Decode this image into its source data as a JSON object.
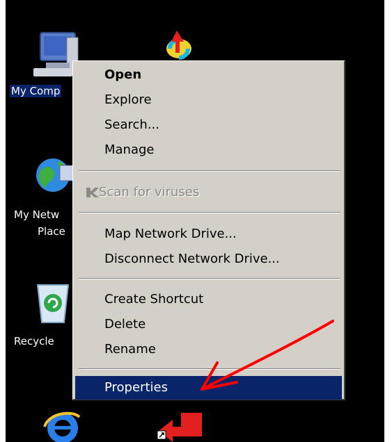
{
  "desktop": {
    "icons": [
      {
        "name": "my-computer",
        "label": "My Comp"
      },
      {
        "name": "my-network-places",
        "label_line1": "My Netw",
        "label_line2": "Place"
      },
      {
        "name": "recycle-bin",
        "label": "Recycle"
      },
      {
        "name": "internet-explorer",
        "label": ""
      }
    ]
  },
  "context_menu": {
    "items": [
      {
        "label": "Open",
        "bold": true
      },
      {
        "label": "Explore"
      },
      {
        "label": "Search..."
      },
      {
        "label": "Manage"
      },
      {
        "label": "Scan for viruses",
        "disabled": true,
        "icon": "kaspersky-icon"
      },
      {
        "label": "Map Network Drive..."
      },
      {
        "label": "Disconnect Network Drive..."
      },
      {
        "label": "Create Shortcut"
      },
      {
        "label": "Delete"
      },
      {
        "label": "Rename"
      },
      {
        "label": "Properties",
        "selected": true
      }
    ]
  },
  "colors": {
    "menu_bg": "#d4d0c8",
    "selection": "#0a246a",
    "annotation_arrow": "#ff0000"
  }
}
